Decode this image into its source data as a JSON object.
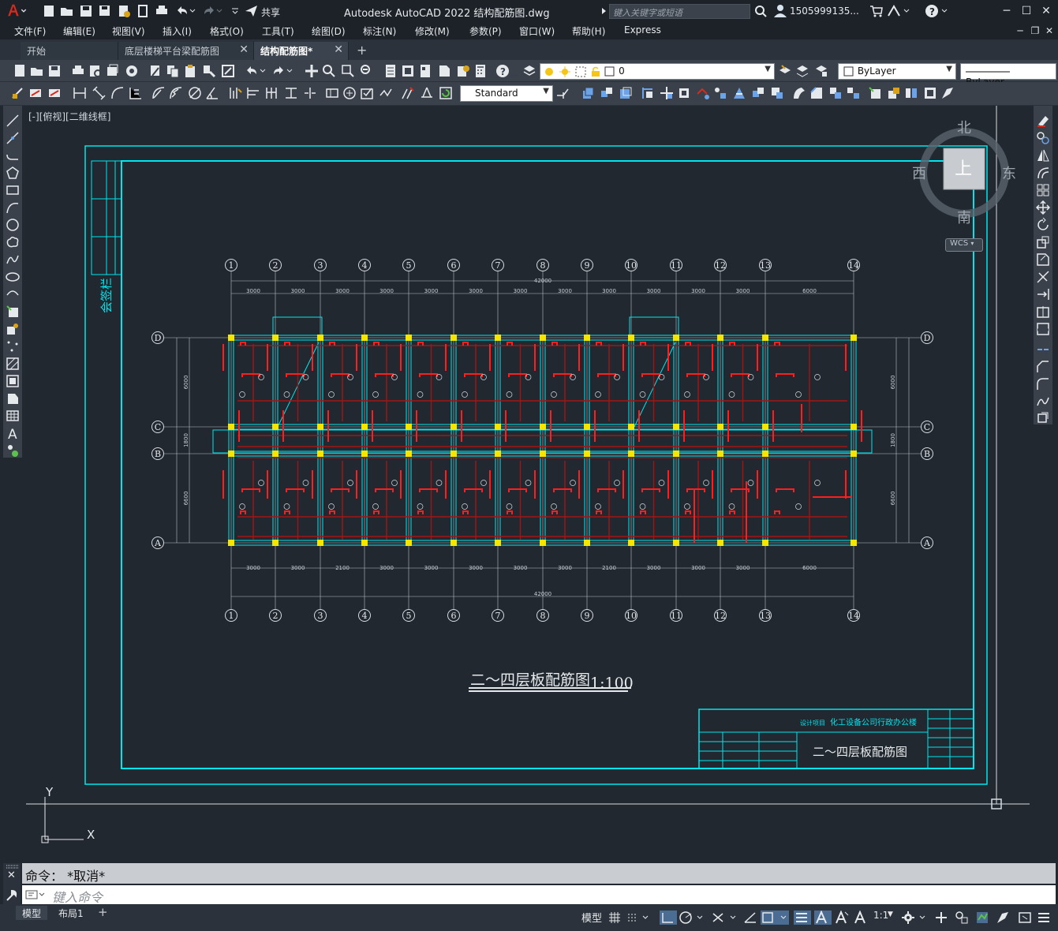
{
  "app": {
    "title": "Autodesk AutoCAD 2022    结构配筋图.dwg",
    "share_label": "共享",
    "search_placeholder": "键入关键字或短语",
    "user": "1505999135...",
    "accent": "#d62b1f"
  },
  "menu": [
    "文件(F)",
    "编辑(E)",
    "视图(V)",
    "插入(I)",
    "格式(O)",
    "工具(T)",
    "绘图(D)",
    "标注(N)",
    "修改(M)",
    "参数(P)",
    "窗口(W)",
    "帮助(H)",
    "Express"
  ],
  "tabs": [
    {
      "label": "开始",
      "active": false,
      "closable": false
    },
    {
      "label": "底层楼梯平台梁配筋图",
      "active": false,
      "closable": true
    },
    {
      "label": "结构配筋图*",
      "active": true,
      "closable": true
    }
  ],
  "toolbar": {
    "layer_value": "0",
    "color_value": "ByLayer",
    "linetype_value": "ByLayer",
    "text_style": "Standard"
  },
  "viewport": {
    "label": "[-][俯视][二维线框]",
    "navcube": {
      "north": "北",
      "south": "南",
      "east": "东",
      "west": "西",
      "top": "上",
      "wcs": "WCS"
    },
    "ucs_x": "X",
    "ucs_y": "Y"
  },
  "drawing": {
    "sign_column": "会签栏",
    "plan_title": "二～四层板配筋图",
    "plan_scale": "1:100",
    "titleblock_project_label": "设计项目",
    "titleblock_project": "化工设备公司行政办公楼",
    "titleblock_drawing_name": "二～四层板配筋图",
    "axes_numbers": [
      "1",
      "2",
      "3",
      "4",
      "5",
      "6",
      "7",
      "8",
      "9",
      "10",
      "11",
      "12",
      "13",
      "14"
    ],
    "axes_letters": [
      "D",
      "C",
      "B",
      "A"
    ],
    "top_dims": [
      "3000",
      "3000",
      "3000",
      "3000",
      "3000",
      "3000",
      "3000",
      "3000",
      "3000",
      "3000",
      "3000",
      "3000",
      "6000"
    ],
    "bottom_dims": [
      "3000",
      "3000",
      "2100",
      "3000",
      "3000",
      "3000",
      "3000",
      "3000",
      "2100",
      "3000",
      "3000",
      "3000",
      "6000"
    ],
    "total_dim": "42000",
    "side_dims": [
      "6000",
      "1800",
      "6600"
    ]
  },
  "command": {
    "history": "命令： *取消*",
    "placeholder": "键入命令"
  },
  "status": {
    "layout_tabs": [
      "模型",
      "布局1"
    ],
    "model_label": "模型",
    "scale": "1:1"
  }
}
